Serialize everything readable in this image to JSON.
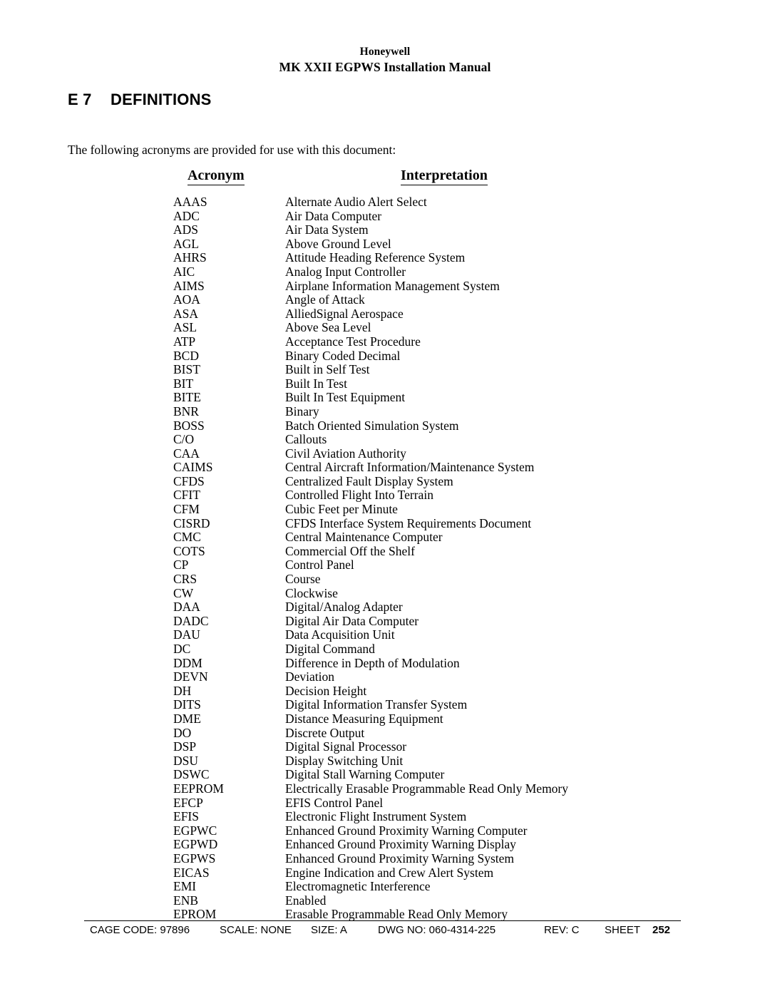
{
  "header": {
    "company": "Honeywell",
    "manual_title": "MK XXII EGPWS Installation Manual"
  },
  "section": {
    "number": "E 7",
    "title": "DEFINITIONS"
  },
  "intro": "The following acronyms are provided for use with this document:",
  "table": {
    "columns": {
      "acronym": "Acronym",
      "interpretation": "Interpretation"
    },
    "rows": [
      {
        "acronym": "AAAS",
        "interpretation": "Alternate Audio Alert Select"
      },
      {
        "acronym": "ADC",
        "interpretation": "Air Data Computer"
      },
      {
        "acronym": "ADS",
        "interpretation": "Air Data System"
      },
      {
        "acronym": "AGL",
        "interpretation": "Above Ground Level"
      },
      {
        "acronym": "AHRS",
        "interpretation": "Attitude Heading Reference System"
      },
      {
        "acronym": "AIC",
        "interpretation": "Analog Input Controller"
      },
      {
        "acronym": "AIMS",
        "interpretation": "Airplane Information Management System"
      },
      {
        "acronym": "AOA",
        "interpretation": "Angle of Attack"
      },
      {
        "acronym": "ASA",
        "interpretation": "AlliedSignal Aerospace"
      },
      {
        "acronym": "ASL",
        "interpretation": "Above Sea Level"
      },
      {
        "acronym": "ATP",
        "interpretation": "Acceptance Test Procedure"
      },
      {
        "acronym": "BCD",
        "interpretation": "Binary Coded Decimal"
      },
      {
        "acronym": "BIST",
        "interpretation": "Built in Self Test"
      },
      {
        "acronym": "BIT",
        "interpretation": "Built In Test"
      },
      {
        "acronym": "BITE",
        "interpretation": "Built In Test Equipment"
      },
      {
        "acronym": "BNR",
        "interpretation": "Binary"
      },
      {
        "acronym": "BOSS",
        "interpretation": "Batch Oriented Simulation System"
      },
      {
        "acronym": "C/O",
        "interpretation": "Callouts"
      },
      {
        "acronym": "CAA",
        "interpretation": "Civil Aviation Authority"
      },
      {
        "acronym": "CAIMS",
        "interpretation": "Central Aircraft Information/Maintenance System"
      },
      {
        "acronym": "CFDS",
        "interpretation": "Centralized Fault Display System"
      },
      {
        "acronym": "CFIT",
        "interpretation": "Controlled Flight Into Terrain"
      },
      {
        "acronym": "CFM",
        "interpretation": "Cubic Feet per Minute"
      },
      {
        "acronym": "CISRD",
        "interpretation": "CFDS Interface System Requirements Document"
      },
      {
        "acronym": "CMC",
        "interpretation": "Central Maintenance Computer"
      },
      {
        "acronym": "COTS",
        "interpretation": "Commercial Off the Shelf"
      },
      {
        "acronym": "CP",
        "interpretation": "Control Panel"
      },
      {
        "acronym": "CRS",
        "interpretation": "Course"
      },
      {
        "acronym": "CW",
        "interpretation": "Clockwise"
      },
      {
        "acronym": "DAA",
        "interpretation": "Digital/Analog Adapter"
      },
      {
        "acronym": "DADC",
        "interpretation": "Digital Air Data Computer"
      },
      {
        "acronym": "DAU",
        "interpretation": "Data Acquisition Unit"
      },
      {
        "acronym": "DC",
        "interpretation": "Digital Command"
      },
      {
        "acronym": "DDM",
        "interpretation": "Difference in Depth of Modulation"
      },
      {
        "acronym": "DEVN",
        "interpretation": "Deviation"
      },
      {
        "acronym": "DH",
        "interpretation": "Decision Height"
      },
      {
        "acronym": "DITS",
        "interpretation": "Digital Information Transfer System"
      },
      {
        "acronym": "DME",
        "interpretation": "Distance Measuring Equipment"
      },
      {
        "acronym": "DO",
        "interpretation": "Discrete Output"
      },
      {
        "acronym": "DSP",
        "interpretation": "Digital Signal Processor"
      },
      {
        "acronym": "DSU",
        "interpretation": "Display Switching Unit"
      },
      {
        "acronym": "DSWC",
        "interpretation": "Digital Stall Warning Computer"
      },
      {
        "acronym": "EEPROM",
        "interpretation": "Electrically Erasable Programmable Read Only Memory"
      },
      {
        "acronym": "EFCP",
        "interpretation": "EFIS Control Panel"
      },
      {
        "acronym": "EFIS",
        "interpretation": "Electronic Flight Instrument System"
      },
      {
        "acronym": "EGPWC",
        "interpretation": "Enhanced Ground Proximity Warning Computer"
      },
      {
        "acronym": "EGPWD",
        "interpretation": "Enhanced Ground Proximity Warning Display"
      },
      {
        "acronym": "EGPWS",
        "interpretation": "Enhanced Ground Proximity Warning System"
      },
      {
        "acronym": "EICAS",
        "interpretation": "Engine Indication and Crew Alert System"
      },
      {
        "acronym": "EMI",
        "interpretation": "Electromagnetic Interference"
      },
      {
        "acronym": "ENB",
        "interpretation": "Enabled"
      },
      {
        "acronym": "EPROM",
        "interpretation": "Erasable Programmable Read Only Memory"
      }
    ]
  },
  "footer": {
    "cage_code": "CAGE CODE: 97896",
    "scale": "SCALE: NONE",
    "size": "SIZE: A",
    "dwg_no": "DWG NO: 060-4314-225",
    "rev": "REV: C",
    "sheet_label": "SHEET",
    "sheet_number": "252"
  }
}
